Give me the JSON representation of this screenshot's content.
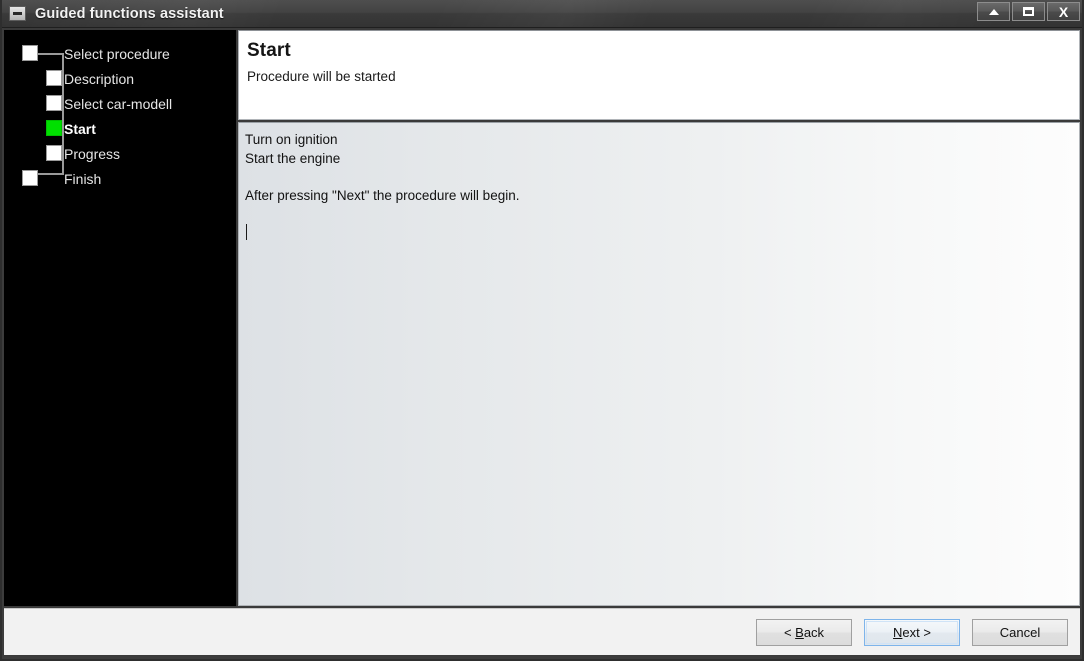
{
  "window": {
    "title": "Guided functions assistant",
    "sysmenu_icon": "minimize-box-icon",
    "controls": [
      {
        "name": "minimize-button",
        "glyph": "up-arrow"
      },
      {
        "name": "restore-button",
        "glyph": "restore-square"
      },
      {
        "name": "close-button",
        "glyph": "X"
      }
    ]
  },
  "sidebar": {
    "items": [
      {
        "label": "Select procedure",
        "state": "pending",
        "indent": 0
      },
      {
        "label": "Description",
        "state": "pending",
        "indent": 1
      },
      {
        "label": "Select car-modell",
        "state": "pending",
        "indent": 1
      },
      {
        "label": "Start",
        "state": "active",
        "indent": 1
      },
      {
        "label": "Progress",
        "state": "pending",
        "indent": 1
      },
      {
        "label": "Finish",
        "state": "pending",
        "indent": 0
      }
    ],
    "active_color": "#00e000",
    "pending_color": "#ffffff",
    "background": "#000000"
  },
  "header": {
    "title": "Start",
    "subtitle": "Procedure will be started"
  },
  "content": {
    "text": "Turn on ignition\nStart the engine\n\nAfter pressing \"Next\" the procedure will begin.",
    "caret_visible": "true"
  },
  "footer": {
    "back_label": "< Back",
    "back_accesskey": "B",
    "next_label": "Next >",
    "next_accesskey": "N",
    "cancel_label": "Cancel",
    "focused_button": "next-button",
    "focus_color": "#7eb4ea"
  }
}
